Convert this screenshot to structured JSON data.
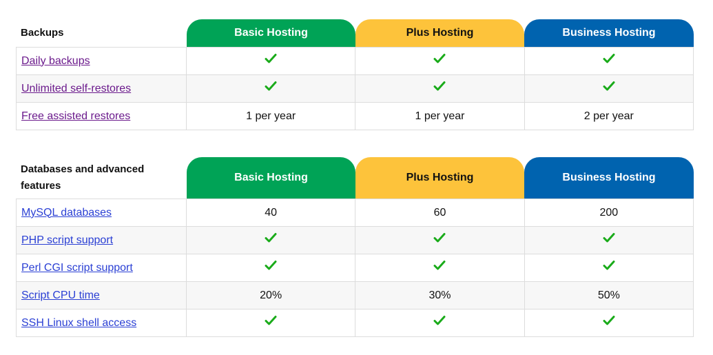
{
  "plans": [
    {
      "label": "Basic Hosting",
      "color": "#00a356"
    },
    {
      "label": "Plus Hosting",
      "color": "#fdc33b"
    },
    {
      "label": "Business Hosting",
      "color": "#0063af"
    }
  ],
  "backups": {
    "title": "Backups",
    "rows": [
      {
        "feature": "Daily backups",
        "values": [
          "check",
          "check",
          "check"
        ]
      },
      {
        "feature": "Unlimited self-restores",
        "values": [
          "check",
          "check",
          "check"
        ]
      },
      {
        "feature": "Free assisted restores",
        "values": [
          "1 per year",
          "1 per year",
          "2 per year"
        ]
      }
    ]
  },
  "databases": {
    "title": "Databases and advanced features",
    "rows": [
      {
        "feature": "MySQL databases",
        "values": [
          "40",
          "60",
          "200"
        ]
      },
      {
        "feature": "PHP script support",
        "values": [
          "check",
          "check",
          "check"
        ]
      },
      {
        "feature": "Perl CGI script support",
        "values": [
          "check",
          "check",
          "check"
        ]
      },
      {
        "feature": "Script CPU time",
        "values": [
          "20%",
          "30%",
          "50%"
        ]
      },
      {
        "feature": "SSH Linux shell access",
        "values": [
          "check",
          "check",
          "check"
        ]
      }
    ]
  },
  "colors": {
    "check": "#1aab1a",
    "visited_link": "#6b1a8c",
    "link": "#2a3fd4"
  }
}
